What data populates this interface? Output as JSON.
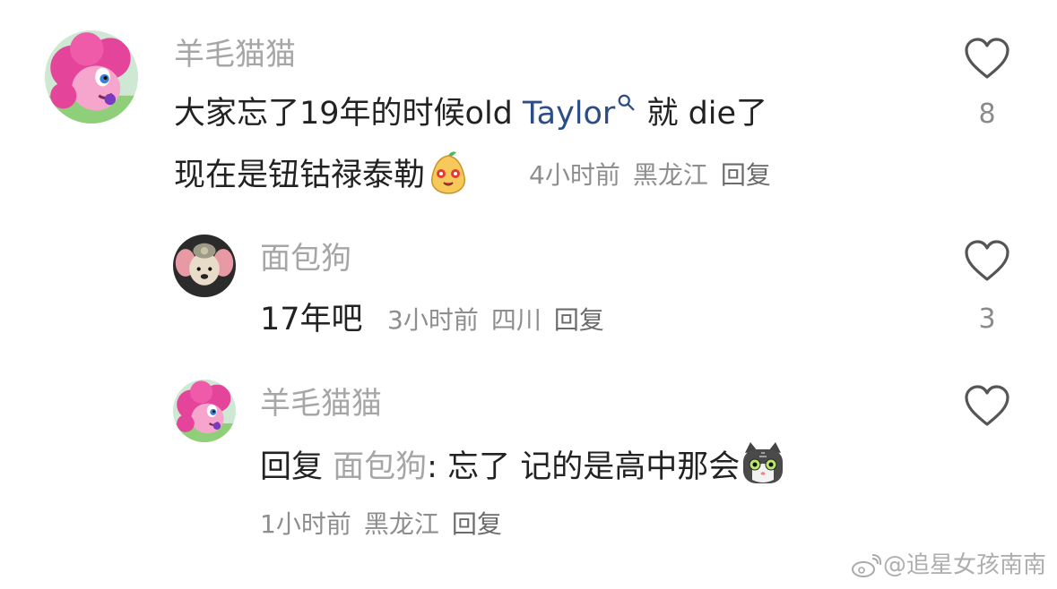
{
  "comments": [
    {
      "username": "羊毛猫猫",
      "text_before": "大家忘了19年的时候old ",
      "link": "Taylor",
      "text_after": " 就 die了",
      "text_line2": "现在是钮钴禄泰勒",
      "emoji": "pear-face-emoji",
      "time": "4小时前",
      "location": "黑龙江",
      "reply_label": "回复",
      "likes": "8"
    },
    {
      "username": "面包狗",
      "text": "17年吧",
      "time": "3小时前",
      "location": "四川",
      "reply_label": "回复",
      "likes": "3"
    },
    {
      "username": "羊毛猫猫",
      "reply_prefix": "回复",
      "mention": "面包狗",
      "text": ": 忘了 记的是高中那会",
      "emoji": "cat-face-emoji",
      "time": "1小时前",
      "location": "黑龙江",
      "reply_label": "回复"
    }
  ],
  "watermark": {
    "text": "@追星女孩南南",
    "icon": "weibo-logo"
  },
  "colors": {
    "username": "#a6a6a6",
    "text": "#222222",
    "link": "#2c4d86",
    "meta": "#8e8e8e"
  }
}
